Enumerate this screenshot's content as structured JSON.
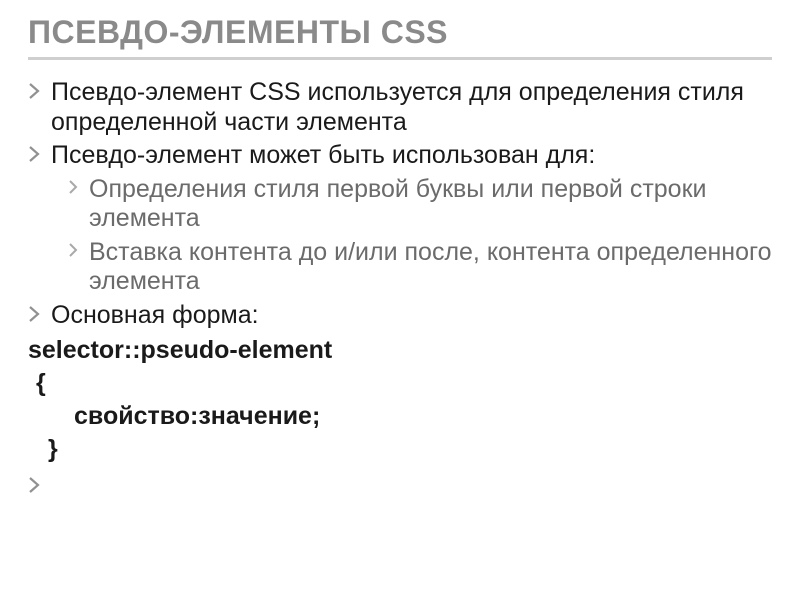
{
  "title": "ПСЕВДО-ЭЛЕМЕНТЫ CSS",
  "bullets": {
    "l1_a": "Псевдо-элемент CSS используется для определения стиля определенной части элемента",
    "l1_b": "Псевдо-элемент может быть использован для:",
    "l2_a": "Определения стиля первой буквы или первой строки элемента",
    "l2_b": "Вставка контента до и/или после, контента определенного элемента",
    "l1_c": "Основная форма:"
  },
  "code": {
    "line1": "selector::pseudo-element",
    "line2": "{",
    "line3": "свойство:значение;",
    "line4": "}"
  },
  "colors": {
    "title": "#8a8a8a",
    "underline": "#cfcfcf",
    "sublist": "#6b6b6b",
    "markerL1": "#919191",
    "markerL2": "#a9a9a9"
  }
}
